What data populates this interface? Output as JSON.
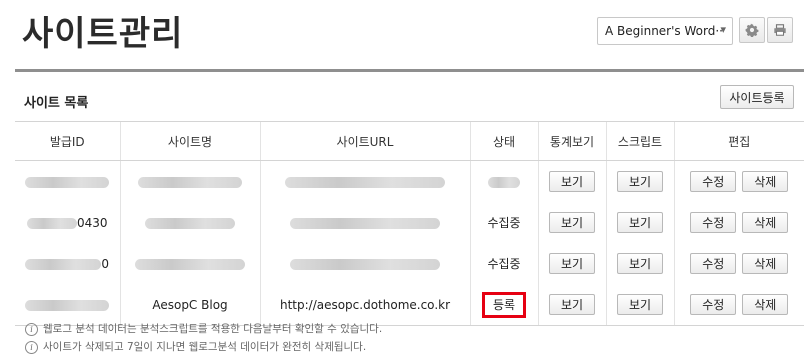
{
  "header": {
    "title": "사이트관리",
    "site_select_value": "A Beginner's Word··",
    "colors": {
      "title": "#2b2b2b",
      "divider": "#8f8f8f",
      "highlight": "#e60012"
    }
  },
  "section": {
    "title": "사이트 목록",
    "register_button": "사이트등록"
  },
  "table": {
    "columns": [
      "발급ID",
      "사이트명",
      "사이트URL",
      "상태",
      "통계보기",
      "스크립트",
      "편집"
    ],
    "rows": [
      {
        "id": "",
        "id_suffix": "",
        "name": "",
        "url": "",
        "status": ""
      },
      {
        "id": "",
        "id_suffix": "0430",
        "name": "",
        "url": "",
        "status": "수집중"
      },
      {
        "id": "",
        "id_suffix": "0",
        "name": "",
        "url": "",
        "status": "수집중"
      },
      {
        "id": "",
        "id_suffix": "",
        "name": "AesopC Blog",
        "url": "http://aesopc.dothome.co.kr",
        "status": "등록"
      }
    ],
    "view_label": "보기",
    "script_label": "보기",
    "edit_label": "수정",
    "delete_label": "삭제"
  },
  "notes": [
    "웹로그 분석 데이터는 분석스크립트를 적용한 다음날부터 확인할 수 있습니다.",
    "사이트가 삭제되고 7일이 지나면 웹로그분석 데이터가 완전히 삭제됩니다."
  ],
  "icons": {
    "settings": "gear-icon",
    "print": "print-icon",
    "info": "info-icon",
    "dropdown": "chevron-down-icon"
  }
}
